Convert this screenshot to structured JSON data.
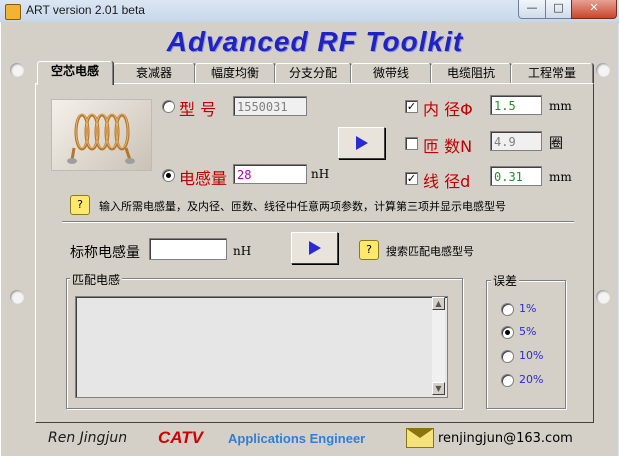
{
  "window": {
    "title": "ART version 2.01 beta",
    "min": "—",
    "max": "□",
    "close": "✕"
  },
  "app_title": "Advanced RF Toolkit",
  "tabs": [
    "空芯电感",
    "衰减器",
    "幅度均衡",
    "分支分配",
    "微带线",
    "电缆阻抗",
    "工程常量"
  ],
  "calc": {
    "model_label": "型  号",
    "model_value": "1550031",
    "inductance_label": "电感量",
    "inductance_value": "28",
    "inductance_unit": "nH",
    "inner_diameter_label": "内  径Φ",
    "inner_diameter_value": "1.5",
    "inner_diameter_unit": "mm",
    "turns_label": "匝  数N",
    "turns_value": "4.9",
    "turns_unit": "圈",
    "wire_diameter_label": "线  径d",
    "wire_diameter_value": "0.31",
    "wire_diameter_unit": "mm",
    "checkbox_mark": "✓",
    "hint": "输入所需电感量，及内径、匝数、线径中任意两项参数，计算第三项并显示电感型号"
  },
  "search": {
    "label": "标称电感量",
    "value": "",
    "unit": "nH",
    "hint": "搜索匹配电感型号"
  },
  "match": {
    "group_label": "匹配电感",
    "up_arrow": "▲",
    "down_arrow": "▼"
  },
  "tolerance": {
    "group_label": "误差",
    "options": [
      "1%",
      "5%",
      "10%",
      "20%"
    ],
    "selected": "5%"
  },
  "footer": {
    "author": "Ren Jingjun",
    "brand": "CATV",
    "role": "Applications Engineer",
    "email": "renjingjun@163.com"
  }
}
